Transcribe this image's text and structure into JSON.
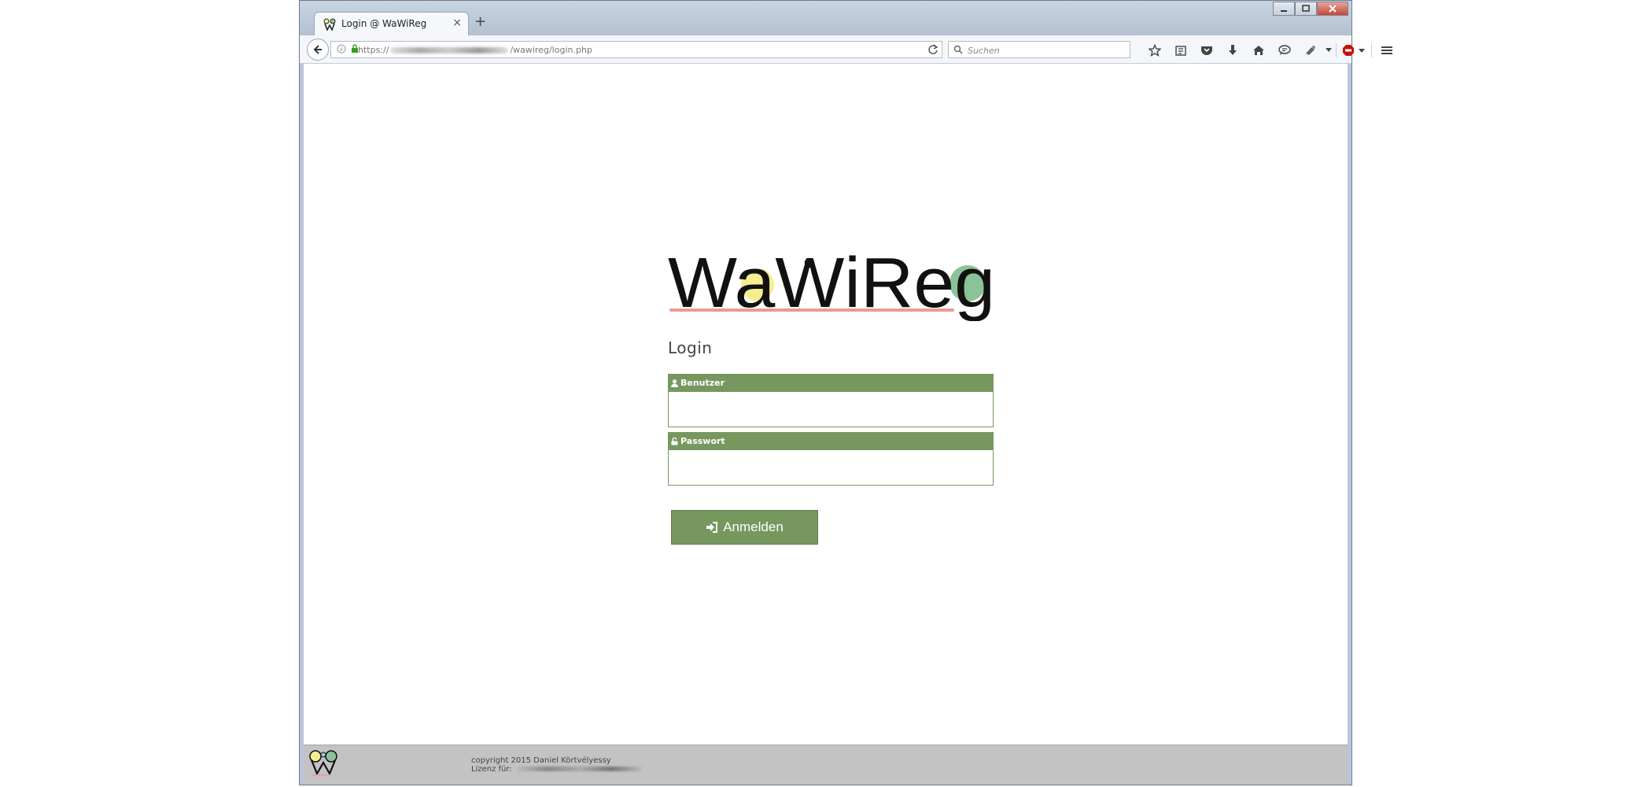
{
  "browser": {
    "tab_title": "Login @ WaWiReg",
    "url_prefix": "https://",
    "url_suffix": "/wawireg/login.php",
    "search_placeholder": "Suchen",
    "toolbar_icons": [
      "star-icon",
      "reading-list-icon",
      "pocket-icon",
      "download-icon",
      "home-icon",
      "chat-icon",
      "extension-icon",
      "dropdown-icon",
      "adblock-icon",
      "menu-icon"
    ]
  },
  "page": {
    "logo_text": "WaWiReg",
    "login_title": "Login",
    "user_label": "Benutzer",
    "user_value": "",
    "password_label": "Passwort",
    "password_value": "",
    "submit_label": "Anmelden"
  },
  "footer": {
    "copyright": "copyright 2015 Daniel Körtvélyessy",
    "license_label": "Lizenz für:"
  },
  "colors": {
    "accent_green": "#76985f",
    "logo_yellow": "#f5ee8f",
    "logo_green": "#8bc398",
    "logo_blue": "#a9c7e6",
    "logo_underline": "#e99a98"
  }
}
